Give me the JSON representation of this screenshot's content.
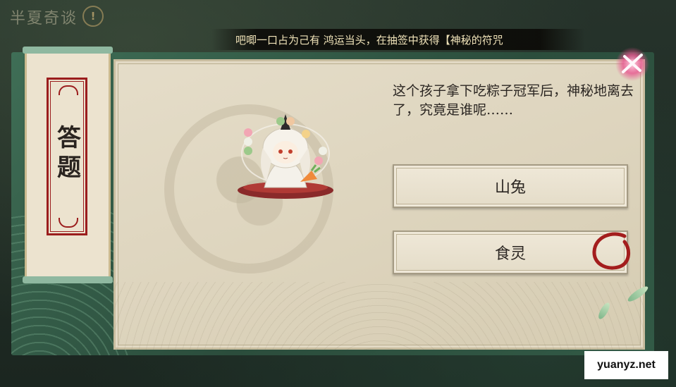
{
  "event": {
    "title": "半夏奇谈",
    "warn_icon": "!"
  },
  "marquee": {
    "text": "吧唧一口占为己有 鸿运当头，在抽签中获得【神秘的符咒"
  },
  "side_panel": {
    "title": "答题"
  },
  "question": {
    "text": "这个孩子拿下吃粽子冠军后，神秘地离去了，究竟是谁呢……"
  },
  "options": [
    {
      "label": "山兔"
    },
    {
      "label": "食灵"
    }
  ],
  "icons": {
    "close": "close-icon",
    "selection_mark": "red-brush-circle-icon",
    "character": "character-shikigami-icon"
  },
  "colors": {
    "accent_red": "#a31d1d",
    "panel_green": "#2f5a45",
    "paper": "#e2dac6"
  },
  "watermark": {
    "text": "yuanyz.net"
  }
}
